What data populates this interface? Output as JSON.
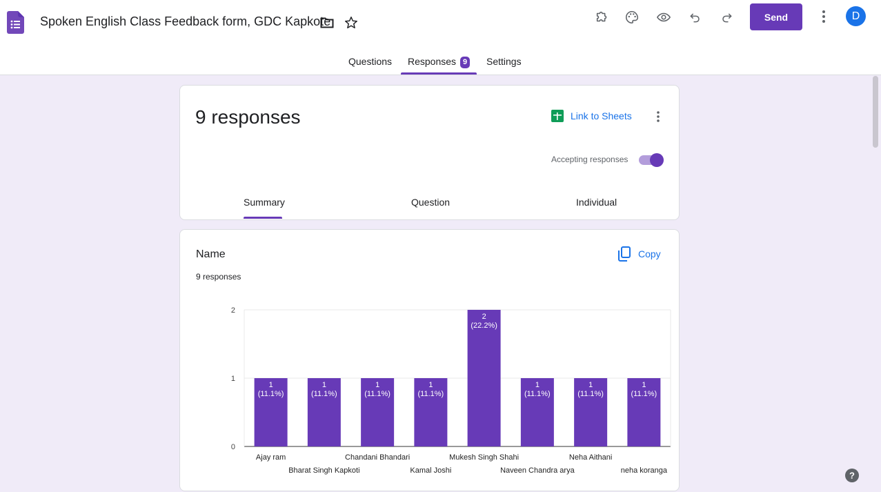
{
  "header": {
    "title": "Spoken English Class Feedback form, GDC Kapkote",
    "send_label": "Send",
    "avatar_initial": "D"
  },
  "tabs": [
    {
      "label": "Questions"
    },
    {
      "label": "Responses",
      "badge": "9",
      "active": true
    },
    {
      "label": "Settings"
    }
  ],
  "summary_card": {
    "response_count": "9 responses",
    "link_sheets_label": "Link to Sheets",
    "accepting_label": "Accepting responses",
    "accepting_on": true,
    "sub_tabs": [
      {
        "label": "Summary",
        "active": true
      },
      {
        "label": "Question"
      },
      {
        "label": "Individual"
      }
    ]
  },
  "question_card": {
    "title": "Name",
    "subtitle": "9 responses",
    "copy_label": "Copy"
  },
  "colors": {
    "accent": "#673ab7",
    "background": "#f0ebf8",
    "link": "#1a73e8",
    "sheets_green": "#0f9d58"
  },
  "icons": [
    "forms-logo-icon",
    "folder-icon",
    "star-icon",
    "addon-puzzle-icon",
    "palette-icon",
    "preview-eye-icon",
    "undo-icon",
    "redo-icon",
    "more-vert-icon",
    "sheets-icon",
    "copy-icon",
    "help-icon"
  ],
  "chart_data": {
    "type": "bar",
    "categories": [
      "Ajay ram",
      "Bharat Singh Kapkoti",
      "Chandani Bhandari",
      "Kamal Joshi",
      "Mukesh Singh Shahi",
      "Naveen Chandra arya",
      "Neha Aithani",
      "neha koranga"
    ],
    "values": [
      1,
      1,
      1,
      1,
      2,
      1,
      1,
      1
    ],
    "labels": [
      "(11.1%)",
      "(11.1%)",
      "(11.1%)",
      "(11.1%)",
      "(22.2%)",
      "(11.1%)",
      "(11.1%)",
      "(11.1%)"
    ],
    "ylim": [
      0,
      2
    ],
    "yticks": [
      "0",
      "1",
      "2"
    ],
    "bar_color": "#673ab7",
    "grid": true
  }
}
